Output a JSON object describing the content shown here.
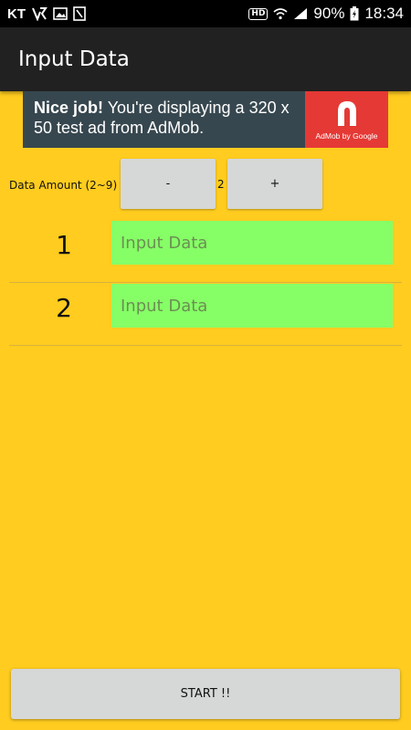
{
  "status_bar": {
    "carrier": "KT",
    "battery": "90%",
    "time": "18:34",
    "hd_label": "HD",
    "icons": [
      "vpn-key-icon",
      "image-icon",
      "clipboard-icon",
      "hd-icon",
      "wifi-icon",
      "signal-icon",
      "battery-charging-icon"
    ]
  },
  "app_bar": {
    "title": "Input Data"
  },
  "ad": {
    "bold": "Nice job!",
    "text": " You're displaying a 320 x 50 test ad from AdMob.",
    "logo_caption": "AdMob by Google"
  },
  "amount": {
    "label": "Data Amount (2~9)",
    "minus_label": "-",
    "value": "2",
    "plus_label": "+"
  },
  "rows": [
    {
      "number": "1",
      "placeholder": "Input Data",
      "value": ""
    },
    {
      "number": "2",
      "placeholder": "Input Data",
      "value": ""
    }
  ],
  "start_label": "START !!",
  "colors": {
    "background": "#FFCC1F",
    "app_bar": "#212121",
    "input_bg": "#86FF67",
    "button_bg": "#D6D7D7",
    "ad_bg": "#37474F",
    "ad_logo_bg": "#E53935"
  }
}
